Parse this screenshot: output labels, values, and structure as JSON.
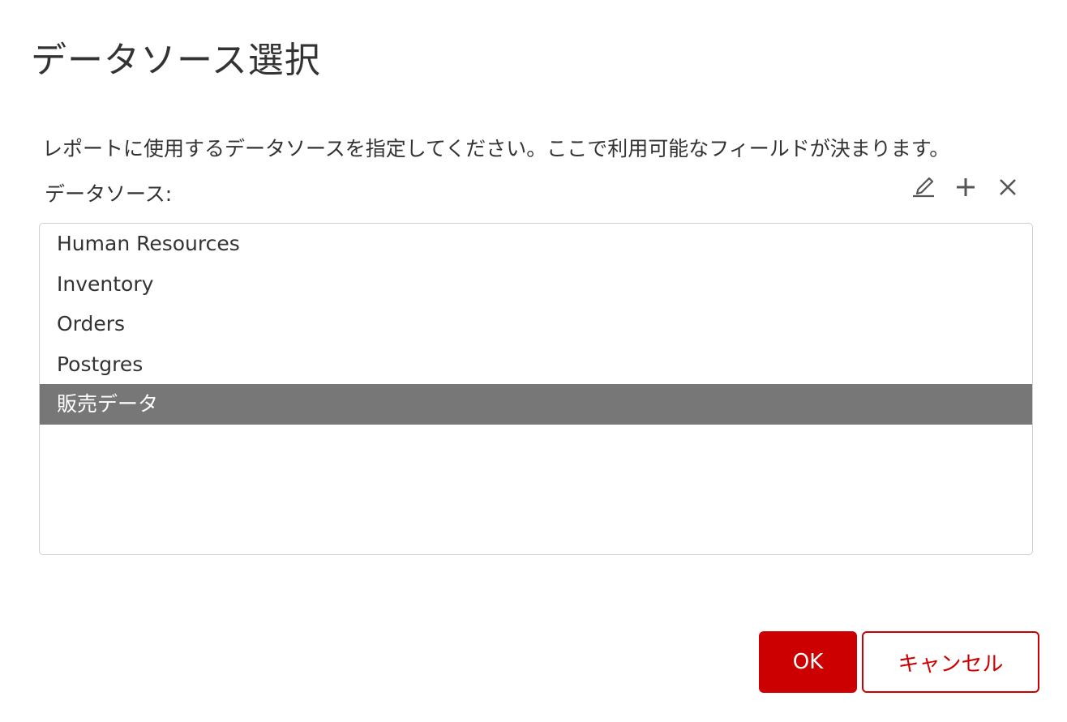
{
  "dialog": {
    "title": "データソース選択",
    "description": "レポートに使用するデータソースを指定してください。ここで利用可能なフィールドが決まります。",
    "field_label": "データソース:"
  },
  "toolbar": {
    "edit_icon": "pencil-icon",
    "add_icon": "plus-icon",
    "remove_icon": "close-icon"
  },
  "datasources": {
    "items": [
      {
        "label": "Human Resources",
        "selected": false
      },
      {
        "label": "Inventory",
        "selected": false
      },
      {
        "label": "Orders",
        "selected": false
      },
      {
        "label": "Postgres",
        "selected": false
      },
      {
        "label": "販売データ",
        "selected": true
      }
    ],
    "selected_color": "#777777"
  },
  "buttons": {
    "ok_label": "OK",
    "cancel_label": "キャンセル",
    "accent_color": "#cc0000"
  }
}
